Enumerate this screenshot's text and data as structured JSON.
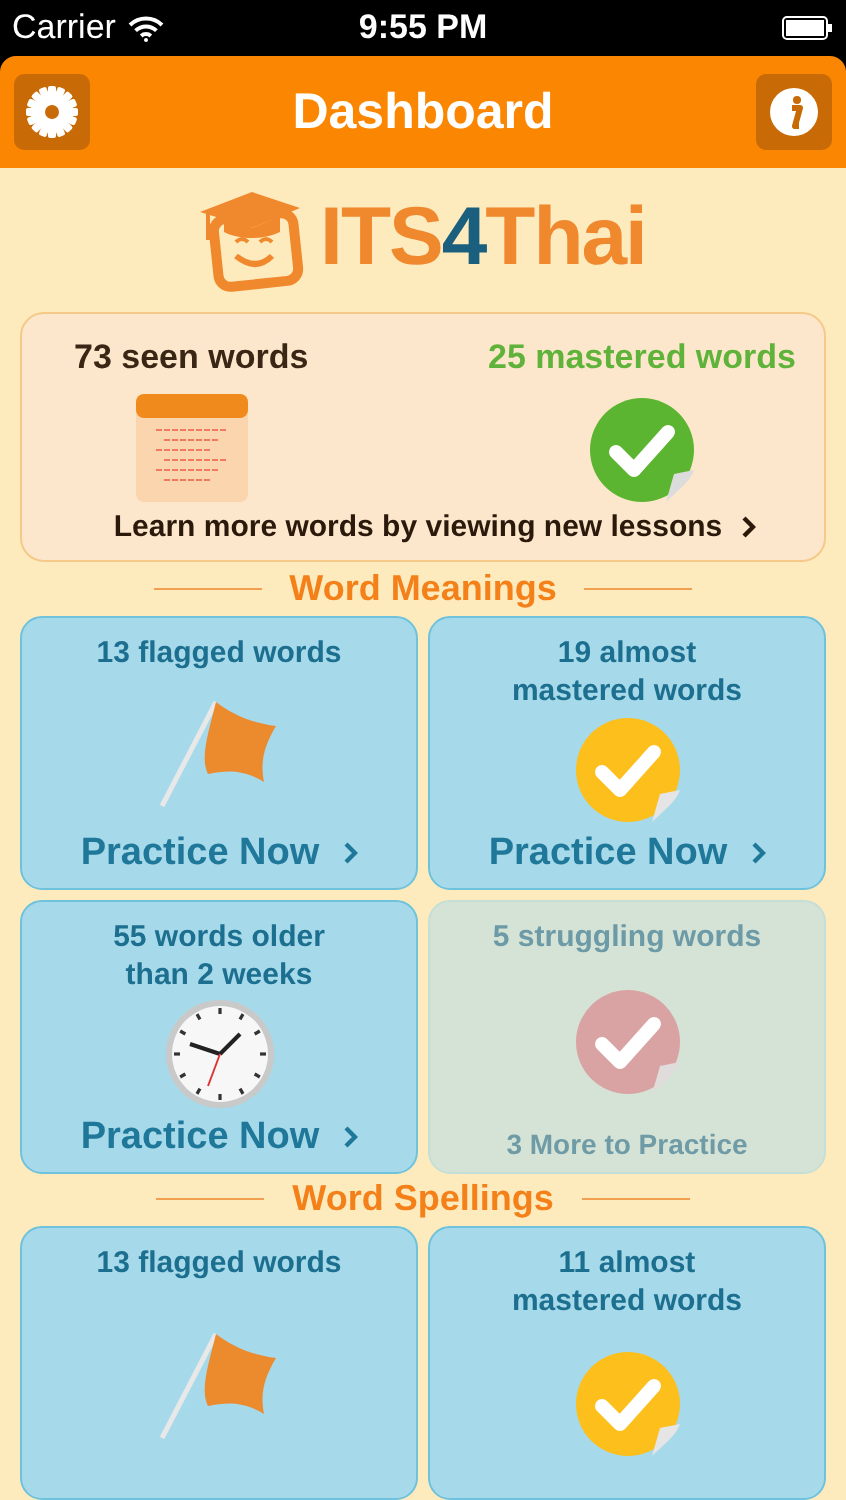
{
  "status_bar": {
    "carrier": "Carrier",
    "time": "9:55 PM"
  },
  "nav_bar": {
    "title": "Dashboard"
  },
  "logo": {
    "parts": [
      {
        "text": "ITS",
        "color": "#f0882e"
      },
      {
        "text": "4",
        "color": "#1b5f7e"
      },
      {
        "text": "Thai",
        "color": "#f0882e"
      }
    ]
  },
  "summary": {
    "seen": "73 seen words",
    "mastered": "25 mastered words",
    "link": "Learn more words by viewing new lessons"
  },
  "sections": [
    {
      "title": "Word Meanings",
      "cards": [
        {
          "kind": "flagged",
          "title": "13 flagged words",
          "action": "Practice Now",
          "disabled": false
        },
        {
          "kind": "almost",
          "title": "19 almost\nmastered words",
          "action": "Practice Now",
          "disabled": false
        },
        {
          "kind": "older",
          "title": "55 words older\nthan 2 weeks",
          "action": "Practice Now",
          "disabled": false
        },
        {
          "kind": "struggling",
          "title": "5 struggling words",
          "note": "3 More to Practice",
          "disabled": true
        }
      ]
    },
    {
      "title": "Word Spellings",
      "cards": [
        {
          "kind": "flagged",
          "title": "13 flagged words",
          "disabled": false
        },
        {
          "kind": "almost",
          "title": "11 almost\nmastered words",
          "disabled": false
        }
      ]
    }
  ]
}
